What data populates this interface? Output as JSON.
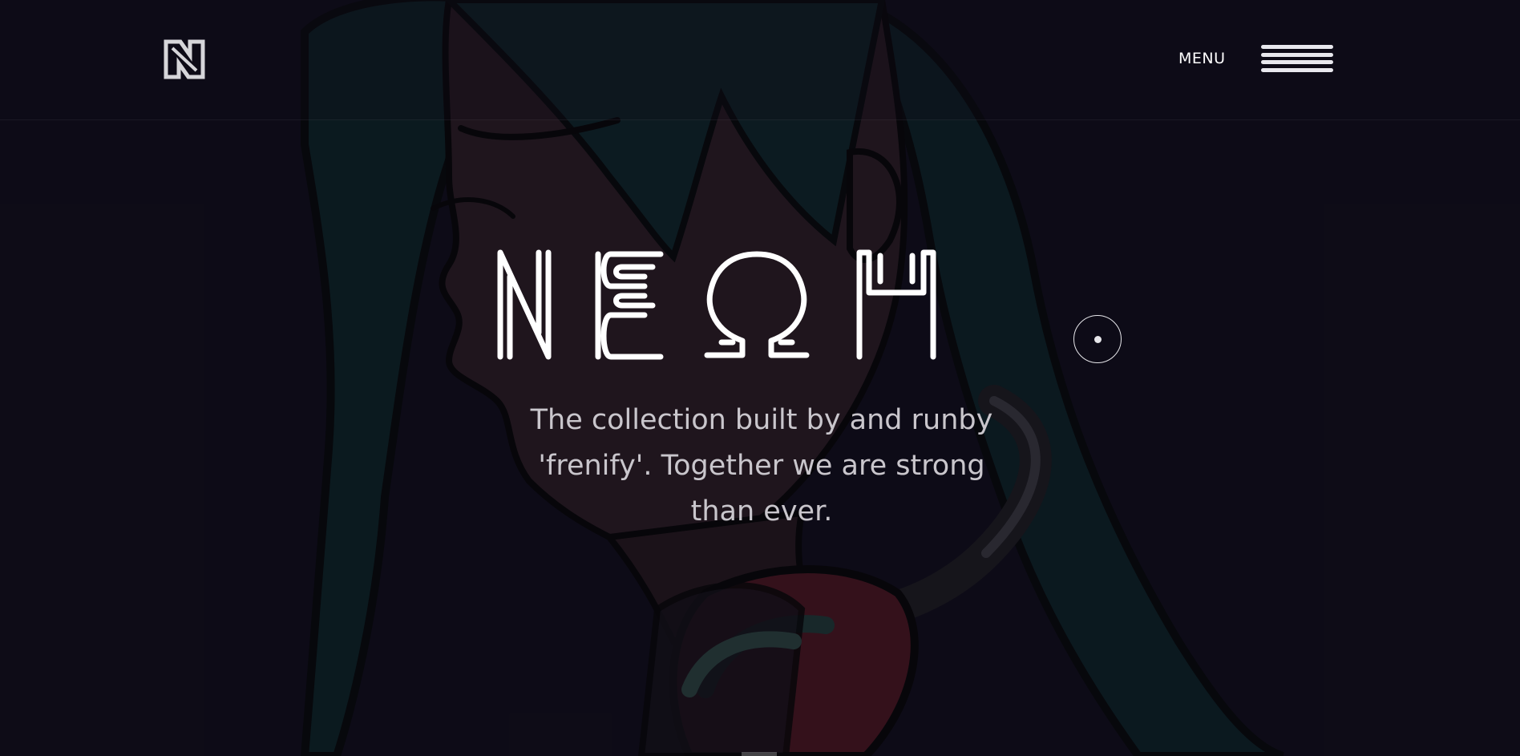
{
  "header": {
    "logo_icon": "neoh-logo-icon",
    "menu_label": "MENU",
    "menu_icon": "hamburger-icon"
  },
  "hero": {
    "title": "NEOH",
    "tagline": "The collection built by and runby 'frenify'. Together we are strong than ever.",
    "scroll_icon": "scroll-down-icon"
  },
  "colors": {
    "background": "#0f0d19",
    "text": "#ffffff",
    "tagline": "#c9c6cc",
    "hair": "#0e2a2c",
    "skin": "#2a1c22",
    "headphone_red": "#5a1a22"
  }
}
